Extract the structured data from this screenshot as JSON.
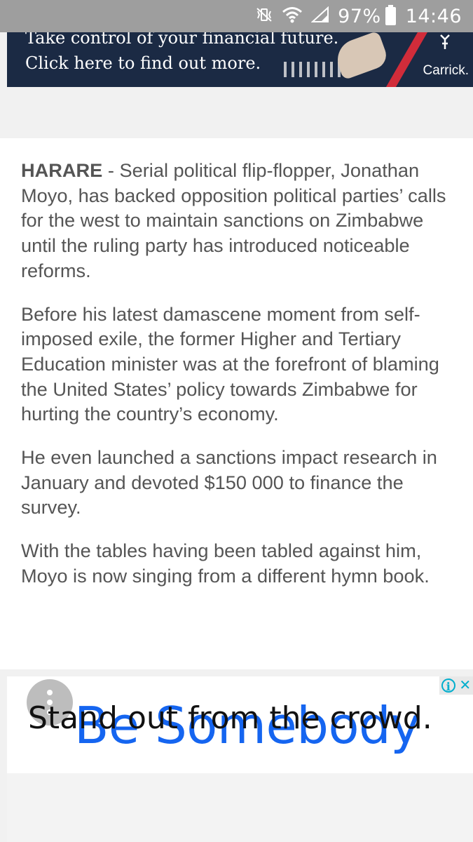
{
  "status_bar": {
    "battery": "97%",
    "time": "14:46",
    "icons": [
      "mute-vibrate-icon",
      "wifi-icon",
      "signal-icon",
      "battery-icon"
    ]
  },
  "top_ad": {
    "line1": "Take control of your financial future.",
    "line2": "Click here to find out more.",
    "brand": "Carrick."
  },
  "article": {
    "paragraphs": [
      {
        "dateline": "HARARE",
        "text": " - Serial political flip-flopper, Jonathan Moyo, has backed opposition political parties’ calls for the west to maintain sanctions on Zimbabwe until the ruling party has introduced noticeable reforms."
      },
      {
        "text": "Before his latest damascene moment from self-imposed exile, the former Higher and Tertiary Education minister was at the forefront of blaming the United States’ policy towards Zimbabwe for hurting the country’s economy."
      },
      {
        "text": "He even launched a sanctions impact research in January and devoted $150 000 to finance the survey."
      },
      {
        "text": "With the tables having been tabled against him, Moyo is now singing from a different hymn book."
      }
    ]
  },
  "bottom_ad": {
    "title": "Be Somebody",
    "body": "Stand out from the crowd.",
    "colors": {
      "title": "#1565f0",
      "controls": "#00aecd"
    }
  }
}
